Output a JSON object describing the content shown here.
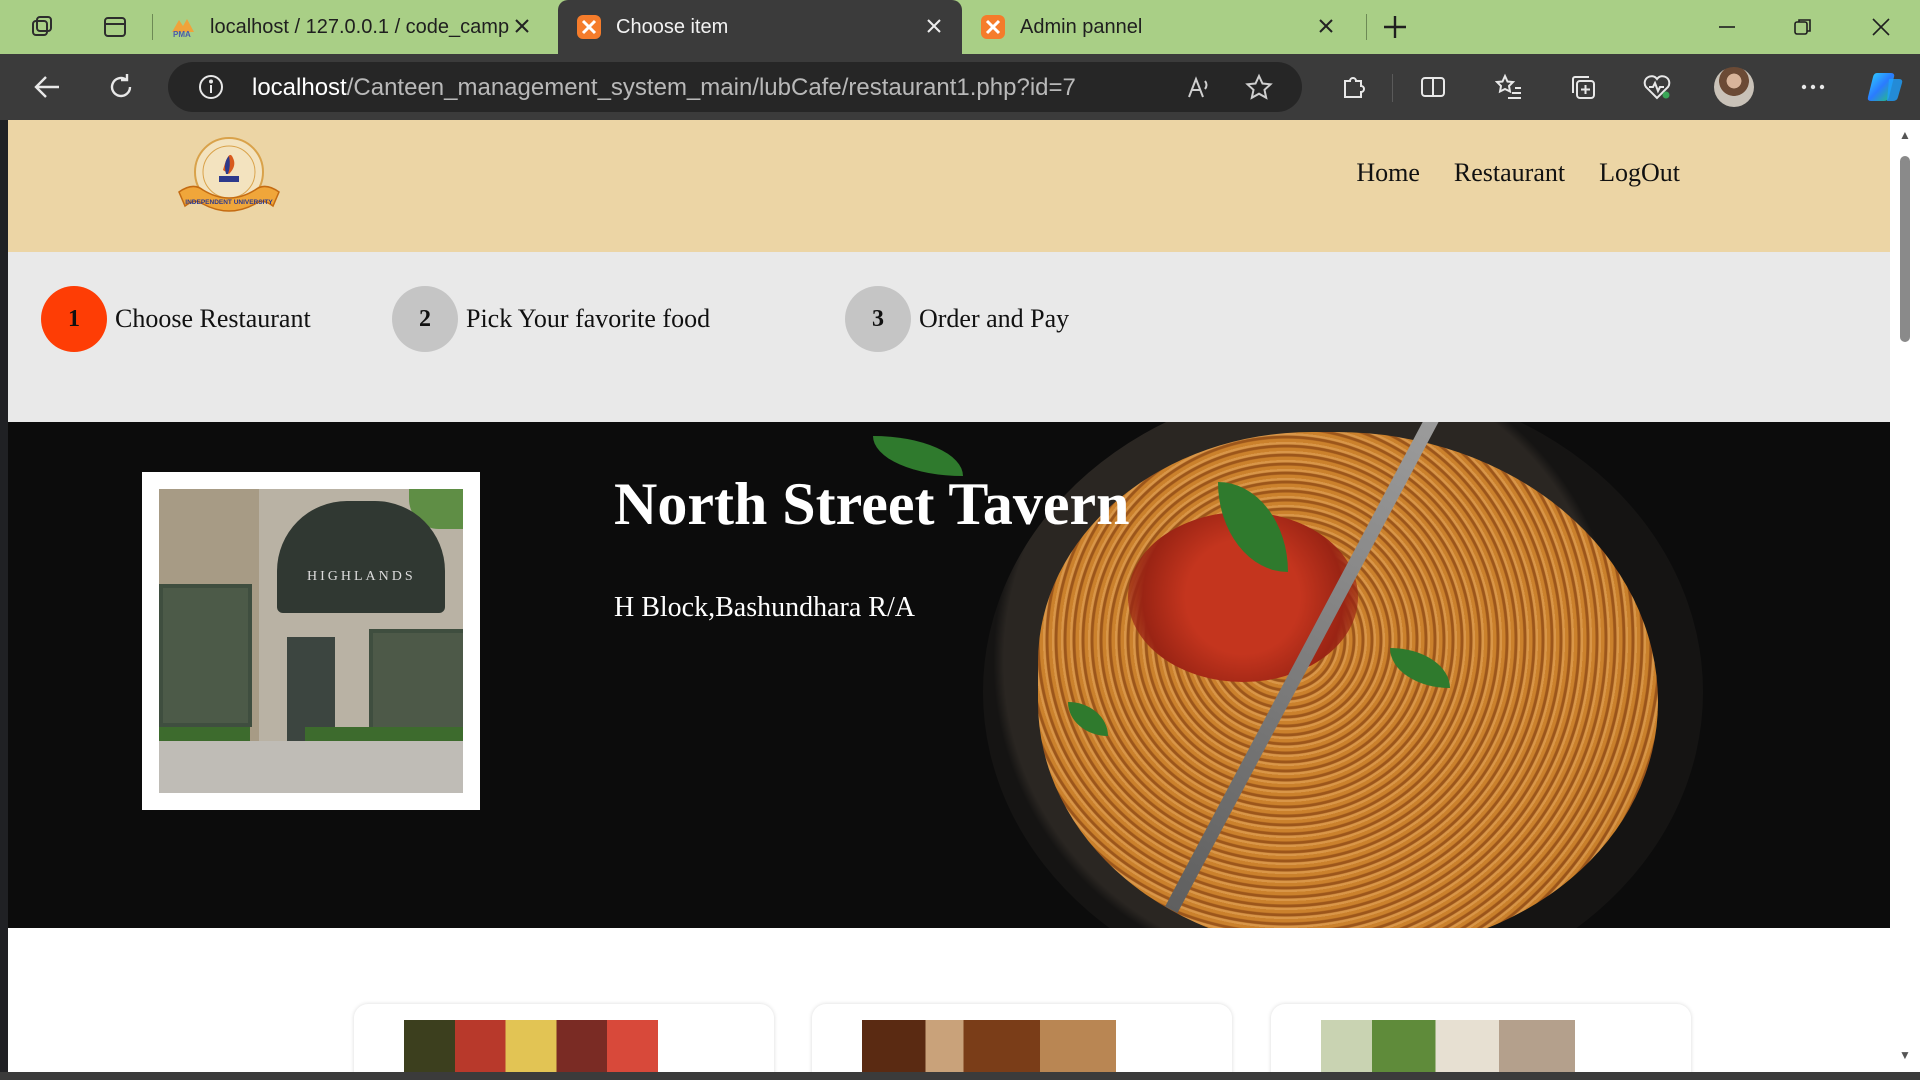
{
  "browser": {
    "tabs": [
      {
        "title": "localhost / 127.0.0.1 / code_camp",
        "favicon": "phpmyadmin-icon"
      },
      {
        "title": "Choose item",
        "favicon": "xampp-icon"
      },
      {
        "title": "Admin pannel",
        "favicon": "xampp-icon"
      }
    ],
    "url_host": "localhost",
    "url_path": "/Canteen_management_system_main/lubCafe/restaurant1.php?id=7"
  },
  "site": {
    "nav": [
      "Home",
      "Restaurant",
      "LogOut"
    ],
    "steps": [
      {
        "num": "1",
        "label": "Choose Restaurant",
        "active": true
      },
      {
        "num": "2",
        "label": "Pick Your favorite food",
        "active": false
      },
      {
        "num": "3",
        "label": "Order and Pay",
        "active": false
      }
    ],
    "restaurant": {
      "name": "North Street Tavern",
      "address": "H Block,Bashundhara R/A",
      "photo_sign": "HIGHLANDS"
    },
    "logo_text": "INDEPENDENT UNIVERSITY"
  },
  "colors": {
    "header_bg": "#ecd5a5",
    "steps_bg": "#e9e9e9",
    "active_step": "#fe3d05",
    "inactive_step": "#c5c5c5",
    "tabbar": "#a9cf86"
  }
}
